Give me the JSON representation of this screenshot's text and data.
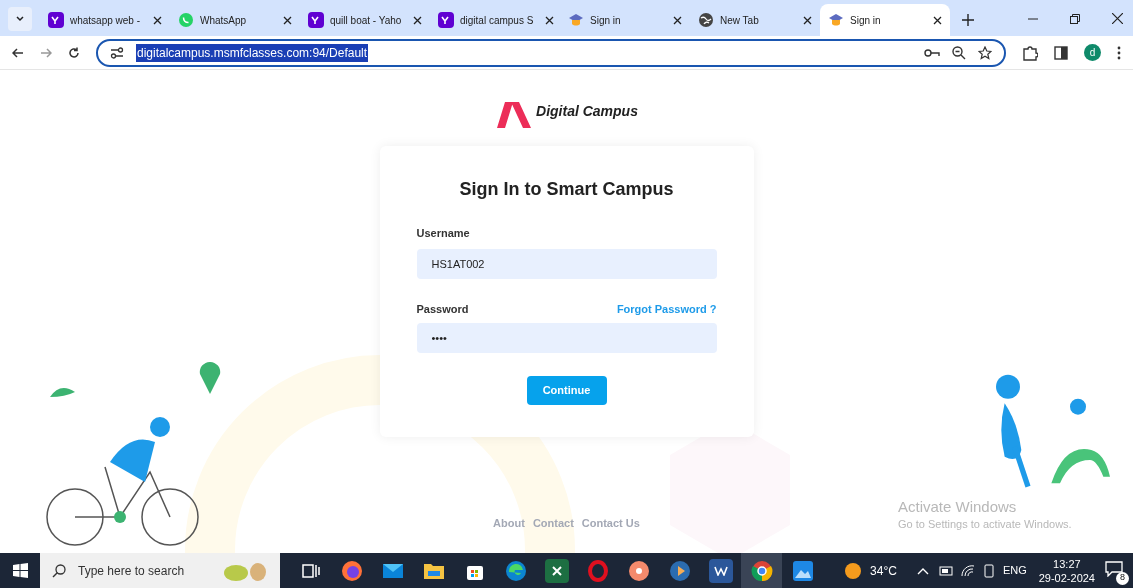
{
  "browser": {
    "tabs": [
      {
        "kind": "yahoo",
        "title": "whatsapp web -",
        "selected": false
      },
      {
        "kind": "whatsapp",
        "title": "WhatsApp",
        "selected": false
      },
      {
        "kind": "yahoo",
        "title": "quill boat - Yaho",
        "selected": false
      },
      {
        "kind": "yahoo",
        "title": "digital campus S",
        "selected": false
      },
      {
        "kind": "campus",
        "title": "Sign in",
        "selected": false
      },
      {
        "kind": "globe",
        "title": "New Tab",
        "selected": false
      },
      {
        "kind": "campus",
        "title": "Sign in",
        "selected": true
      }
    ],
    "url": "digitalcampus.msmfclasses.com:94/Default",
    "profile": "d"
  },
  "page": {
    "brand": "Digital Campus",
    "heading": "Sign In to Smart Campus",
    "username": {
      "label": "Username",
      "value": "HS1AT002"
    },
    "password": {
      "label": "Password",
      "value": "••••",
      "forgot_link": "Forgot Password ?"
    },
    "submit": "Continue",
    "footer_links": [
      "About",
      "Contact",
      "Contact Us"
    ],
    "activation_notice": {
      "title": "Activate Windows",
      "text": "Go to Settings to activate Windows."
    }
  },
  "taskbar": {
    "search_placeholder": "Type here to search",
    "apps": [
      {
        "kind": "taskview",
        "selected": false
      },
      {
        "kind": "firefox",
        "selected": false
      },
      {
        "kind": "mail",
        "selected": false
      },
      {
        "kind": "folder",
        "selected": false
      },
      {
        "kind": "store",
        "selected": false
      },
      {
        "kind": "edge",
        "selected": false
      },
      {
        "kind": "excel",
        "selected": false
      },
      {
        "kind": "opera",
        "selected": false
      },
      {
        "kind": "media",
        "selected": false
      },
      {
        "kind": "player",
        "selected": false
      },
      {
        "kind": "word",
        "selected": false
      },
      {
        "kind": "chrome",
        "selected": true
      },
      {
        "kind": "photos",
        "selected": false
      }
    ],
    "weather": "34°C",
    "language": "ENG",
    "time": "13:27",
    "date": "29-02-2024",
    "notifications": "8"
  }
}
